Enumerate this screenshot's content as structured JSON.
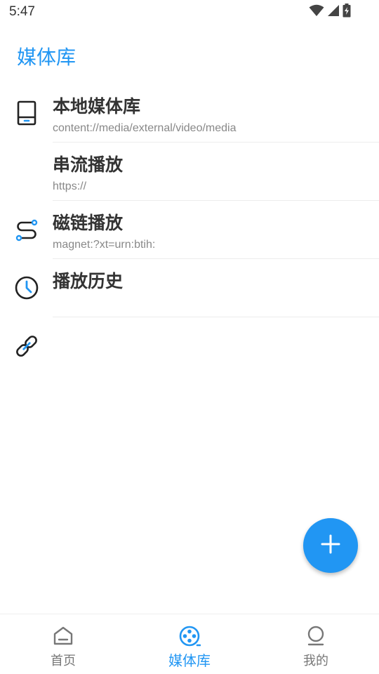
{
  "status_bar": {
    "time": "5:47",
    "icons": [
      "wifi-icon",
      "cell-signal-icon",
      "battery-charging-icon"
    ]
  },
  "header": {
    "title": "媒体库"
  },
  "library_items": [
    {
      "title": "本地媒体库",
      "subtitle": "content://media/external/video/media",
      "icon": "tablet-icon"
    },
    {
      "title": "串流播放",
      "subtitle": "https://",
      "icon": "stream-path-icon"
    },
    {
      "title": "磁链播放",
      "subtitle": "magnet:?xt=urn:btih:",
      "icon": "link-icon"
    },
    {
      "title": "播放历史",
      "subtitle": "",
      "icon": "clock-icon"
    }
  ],
  "fab": {
    "icon": "plus-icon"
  },
  "bottom_nav": {
    "items": [
      {
        "label": "首页",
        "icon": "home-icon",
        "active": false
      },
      {
        "label": "媒体库",
        "icon": "film-reel-icon",
        "active": true
      },
      {
        "label": "我的",
        "icon": "profile-icon",
        "active": false
      }
    ]
  },
  "colors": {
    "accent": "#2196F3",
    "text_primary": "#333333",
    "text_secondary": "#888888",
    "nav_inactive": "#777777"
  }
}
